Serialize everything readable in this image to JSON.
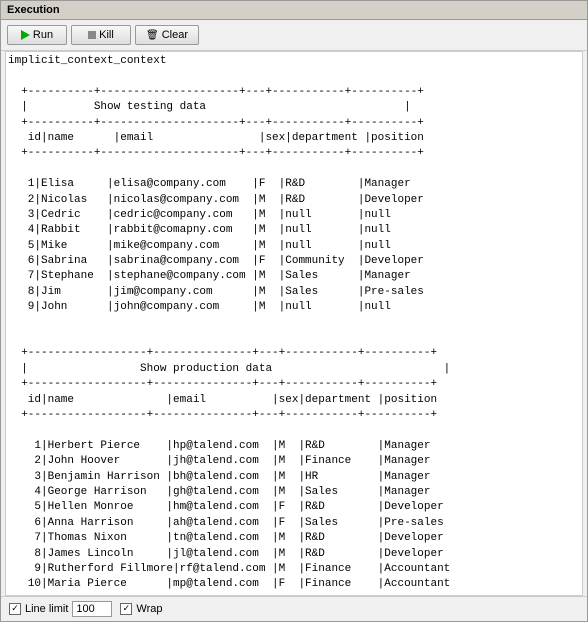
{
  "section": {
    "title": "Execution"
  },
  "toolbar": {
    "run_label": "Run",
    "kill_label": "Kill",
    "clear_label": "Clear"
  },
  "output": {
    "preamble": "implicit_context_context",
    "table1": {
      "title": "Show testing data",
      "header_line1": "=+----------+---------------------+---+-----------+----------",
      "header": " id|name      |email                |sex|department |position  ",
      "header_line2": "=+----------+---------------------+---+-----------+----------",
      "rows": [
        " 1|Elisa     |elisa@company.com    |F  |R&D        |Manager   ",
        " 2|Nicolas   |nicolas@company.com  |M  |R&D        |Developer ",
        " 3|Cedric    |cedric@company.com   |M  |null       |null      ",
        " 4|Rabbit    |rabbit@comapny.com   |M  |null       |null      ",
        " 5|Mike      |mike@company.com     |M  |null       |null      ",
        " 6|Sabrina   |sabrina@company.com  |F  |Community  |Developer ",
        " 7|Stephane  |stephane@company.com |M  |Sales      |Manager   ",
        " 8|Jim       |jim@company.com      |M  |Sales      |Pre-sales ",
        " 9|John      |john@company.com     |M  |null       |null      "
      ]
    },
    "table2": {
      "title": "Show production data",
      "header_line1": "=+------------------+---------------+---+-----------+----------",
      "header": " id|name              |email          |sex|department |position  ",
      "header_line2": "=+------------------+---------------+---+-----------+----------",
      "rows": [
        "  1|Herbert Pierce    |hp@talend.com  |M  |R&D        |Manager   ",
        "  2|John Hoover       |jh@talend.com  |M  |Finance    |Manager   ",
        "  3|Benjamin Harrison |bh@talend.com  |M  |HR         |Manager   ",
        "  4|George Harrison   |gh@talend.com  |M  |Sales      |Manager   ",
        "  5|Hellen Monroe     |hm@talend.com  |F  |R&D        |Developer ",
        "  6|Anna Harrison     |ah@talend.com  |F  |Sales      |Pre-sales ",
        "  7|Thomas Nixon      |tn@talend.com  |M  |R&D        |Developer ",
        "  8|James Lincoln     |jl@talend.com  |M  |R&D        |Developer ",
        "  9|Rutherford Fillmore|rf@talend.com |M  |Finance    |Accountant",
        " 10|Maria Pierce      |mp@talend.com  |F  |Finance    |Accountant"
      ]
    }
  },
  "footer": {
    "line_limit_label": "Line limit",
    "line_limit_value": "100",
    "wrap_label": "Wrap",
    "wrap_checked": true,
    "line_limit_checked": true
  }
}
